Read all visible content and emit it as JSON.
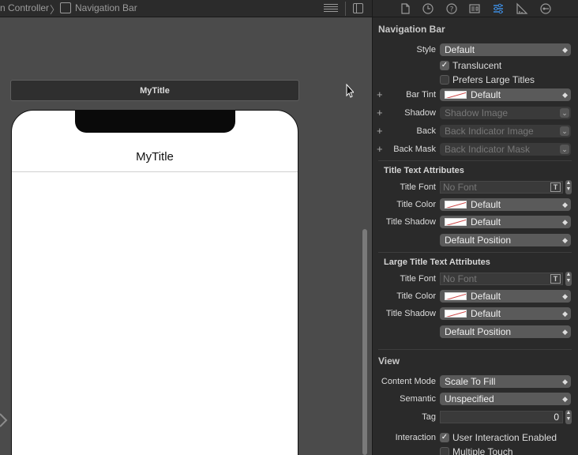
{
  "jumpbar": {
    "crumb1": "n Controller",
    "crumb2": "Navigation Bar"
  },
  "canvas": {
    "scene_title": "MyTitle",
    "nav_title": "MyTitle"
  },
  "inspector": {
    "tabs": [
      "file-icon",
      "history-icon",
      "help-icon",
      "identity-icon",
      "attributes-icon",
      "size-icon",
      "connections-icon"
    ],
    "section_nav": "Navigation Bar",
    "style_label": "Style",
    "style_value": "Default",
    "translucent_label": "Translucent",
    "translucent_checked": true,
    "large_titles_label": "Prefers Large Titles",
    "large_titles_checked": false,
    "bar_tint_label": "Bar Tint",
    "bar_tint_value": "Default",
    "shadow_label": "Shadow",
    "shadow_placeholder": "Shadow Image",
    "back_label": "Back",
    "back_placeholder": "Back Indicator Image",
    "back_mask_label": "Back Mask",
    "back_mask_placeholder": "Back Indicator Mask",
    "title_text_header": "Title Text Attributes",
    "title_font_label": "Title Font",
    "title_font_placeholder": "No Font",
    "title_color_label": "Title Color",
    "title_color_value": "Default",
    "title_shadow_label": "Title Shadow",
    "title_shadow_value": "Default",
    "title_shadow_pos": "Default Position",
    "large_title_header": "Large Title Text Attributes",
    "large_title_font_label": "Title Font",
    "large_title_font_placeholder": "No Font",
    "large_title_color_label": "Title Color",
    "large_title_color_value": "Default",
    "large_title_shadow_label": "Title Shadow",
    "large_title_shadow_value": "Default",
    "large_title_shadow_pos": "Default Position",
    "section_view": "View",
    "content_mode_label": "Content Mode",
    "content_mode_value": "Scale To Fill",
    "semantic_label": "Semantic",
    "semantic_value": "Unspecified",
    "tag_label": "Tag",
    "tag_value": "0",
    "interaction_label": "Interaction",
    "user_interaction_label": "User Interaction Enabled",
    "user_interaction_checked": true,
    "multiple_touch_label": "Multiple Touch",
    "multiple_touch_checked": false,
    "plus": "+",
    "font_glyph": "T",
    "checkmark": "✓",
    "popup_arrow": "⌃⌄"
  },
  "colors": {
    "accent": "#5a5a5a",
    "canvas_bg": "#4b4b4b",
    "inspector_bg": "#2a2a2a"
  }
}
